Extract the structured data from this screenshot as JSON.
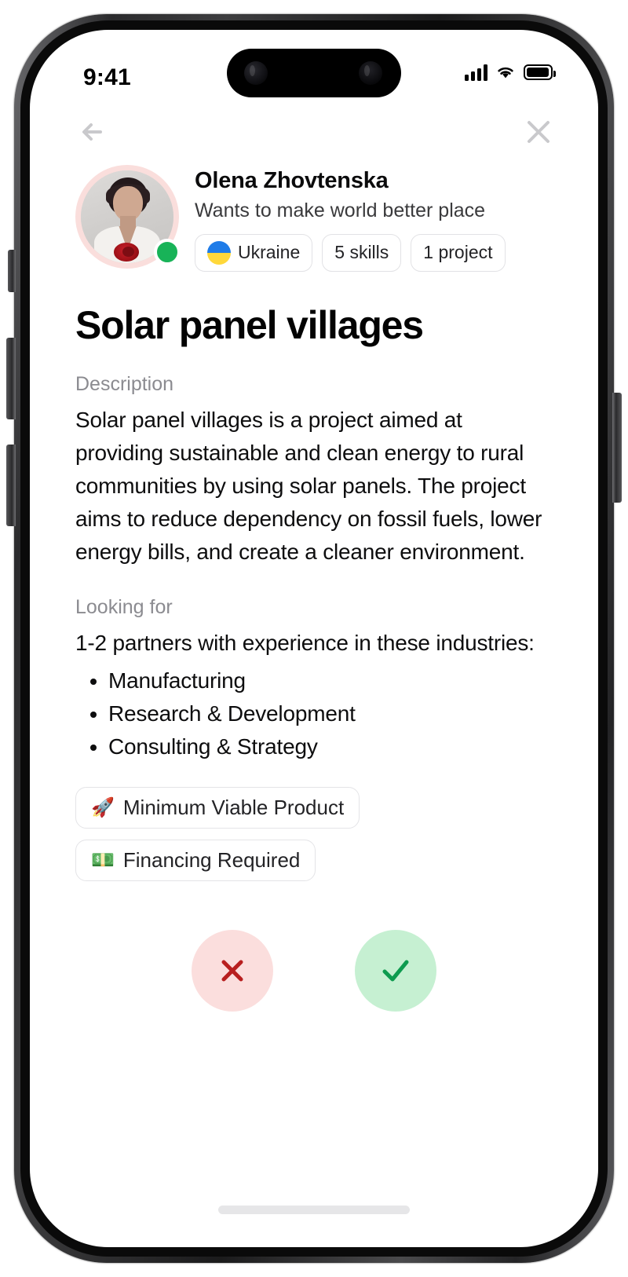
{
  "status_bar": {
    "time": "9:41",
    "signal_icon": "cellular-signal-icon",
    "wifi_icon": "wifi-icon",
    "battery_icon": "battery-icon"
  },
  "nav": {
    "back_icon": "back-arrow-icon",
    "close_icon": "close-icon"
  },
  "profile": {
    "name": "Olena Zhovtenska",
    "tagline": "Wants to make world better place",
    "avatar_name": "olena-zhovtenska-avatar",
    "online_status": "online",
    "chips": [
      {
        "label": "Ukraine",
        "icon": "ukraine-flag-icon"
      },
      {
        "label": "5 skills",
        "icon": ""
      },
      {
        "label": "1 project",
        "icon": ""
      }
    ]
  },
  "project": {
    "title": "Solar panel villages",
    "description_label": "Description",
    "description": "Solar panel villages is a project aimed at providing sustainable and clean energy to rural communities by using solar panels. The project aims to reduce dependency on fossil fuels, lower energy bills, and create a cleaner environment.",
    "looking_for_label": "Looking for",
    "looking_for_intro": "1-2 partners with experience in these industries:",
    "industries": [
      "Manufacturing",
      "Research & Development",
      "Consulting & Strategy"
    ],
    "tags": [
      {
        "emoji": "🚀",
        "label": "Minimum Viable Product",
        "icon": "rocket-icon"
      },
      {
        "emoji": "💵",
        "label": "Financing Required",
        "icon": "money-icon"
      }
    ]
  },
  "actions": {
    "reject_icon": "x-mark-icon",
    "accept_icon": "check-mark-icon",
    "reject_color": "#fbdedd",
    "accept_color": "#c6f0d2",
    "reject_mark_color": "#b81f1f",
    "accept_mark_color": "#0d9b4f"
  },
  "theme": {
    "background": "#ffffff",
    "text_primary": "#0d0d0e",
    "text_muted": "#8b8b90",
    "avatar_ring": "#fadedc",
    "online_dot": "#18b358",
    "chip_border": "#e2e2e5"
  }
}
